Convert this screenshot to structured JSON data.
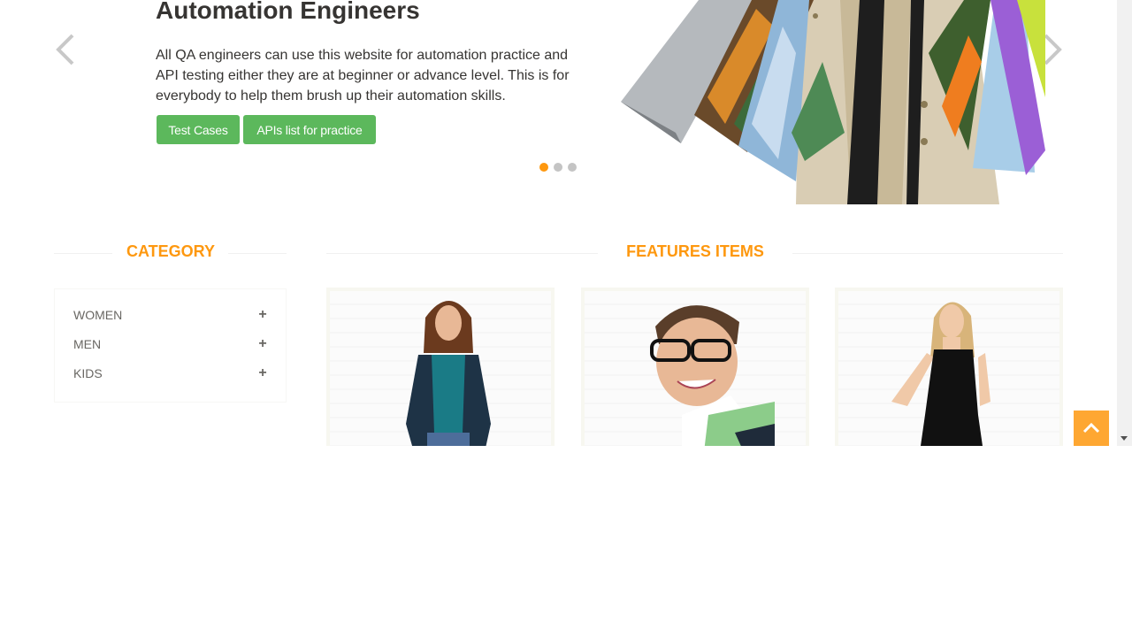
{
  "slider": {
    "title": "Automation Engineers",
    "text": "All QA engineers can use this website for automation practice and API testing either they are at beginner or advance level. This is for everybody to help them brush up their automation skills.",
    "buttons": {
      "test_cases": "Test Cases",
      "apis_list": "APIs list for practice"
    },
    "active_slide_index": 0,
    "slide_count": 3
  },
  "category": {
    "title": "CATEGORY",
    "items": [
      {
        "label": "WOMEN",
        "icon": "plus-icon"
      },
      {
        "label": "MEN",
        "icon": "plus-icon"
      },
      {
        "label": "KIDS",
        "icon": "plus-icon"
      }
    ]
  },
  "features": {
    "title": "FEATURES ITEMS"
  },
  "colors": {
    "accent": "#fe980f",
    "button_green": "#5cb85c",
    "text": "#363432"
  }
}
